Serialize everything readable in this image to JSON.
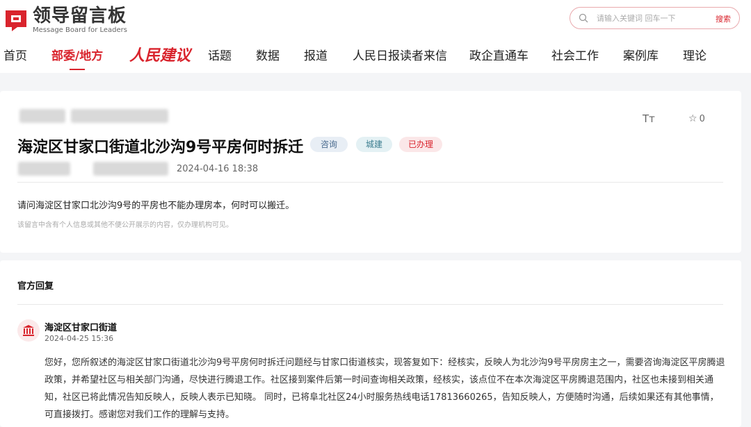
{
  "header": {
    "logo_title": "领导留言板",
    "logo_subtitle": "Message Board for Leaders",
    "search_placeholder": "请输入关键词 回车一下",
    "search_button": "搜索"
  },
  "nav": {
    "items": [
      "首页",
      "部委/地方",
      "人民建议",
      "话题",
      "数据",
      "报道",
      "人民日报读者来信",
      "政企直通车",
      "社会工作",
      "案例库",
      "理论"
    ],
    "active_index": 1
  },
  "post": {
    "title": "海淀区甘家口街道北沙沟9号平房何时拆迁",
    "tags": [
      "咨询",
      "城建",
      "已办理"
    ],
    "time": "2024-04-16 18:38",
    "star_count": "0",
    "font_size_icon": "Tт",
    "content": "请问海淀区甘家口北沙沟9号的平房也不能办理房本，何时可以搬迁。",
    "note": "该留言中含有个人信息或其他不便公开展示的内容，仅办理机构可见。"
  },
  "reply": {
    "heading": "官方回复",
    "org": "海淀区甘家口街道",
    "time": "2024-04-25 15:36",
    "body": "您好，您所叙述的海淀区甘家口街道北沙沟9号平房何时拆迁问题经与甘家口街道核实，现答复如下：经核实，反映人为北沙沟9号平房房主之一，需要咨询海淀区平房腾退政策，并希望社区与相关部门沟通，尽快进行腾退工作。社区接到案件后第一时间查询相关政策，经核实，该点位不在本次海淀区平房腾退范围内，社区也未接到相关通知，社区已将此情况告知反映人，反映人表示已知晓。 同时，已将阜北社区24小时服务热线电话17813660265，告知反映人，方便随时沟通，后续如果还有其他事情，可直接拨打。感谢您对我们工作的理解与支持。"
  },
  "colors": {
    "accent": "#d9242d",
    "page_bg": "#f4f5f7"
  },
  "icons": [
    "logo-icon",
    "search-icon",
    "font-size-icon",
    "star-icon",
    "government-building-icon"
  ]
}
